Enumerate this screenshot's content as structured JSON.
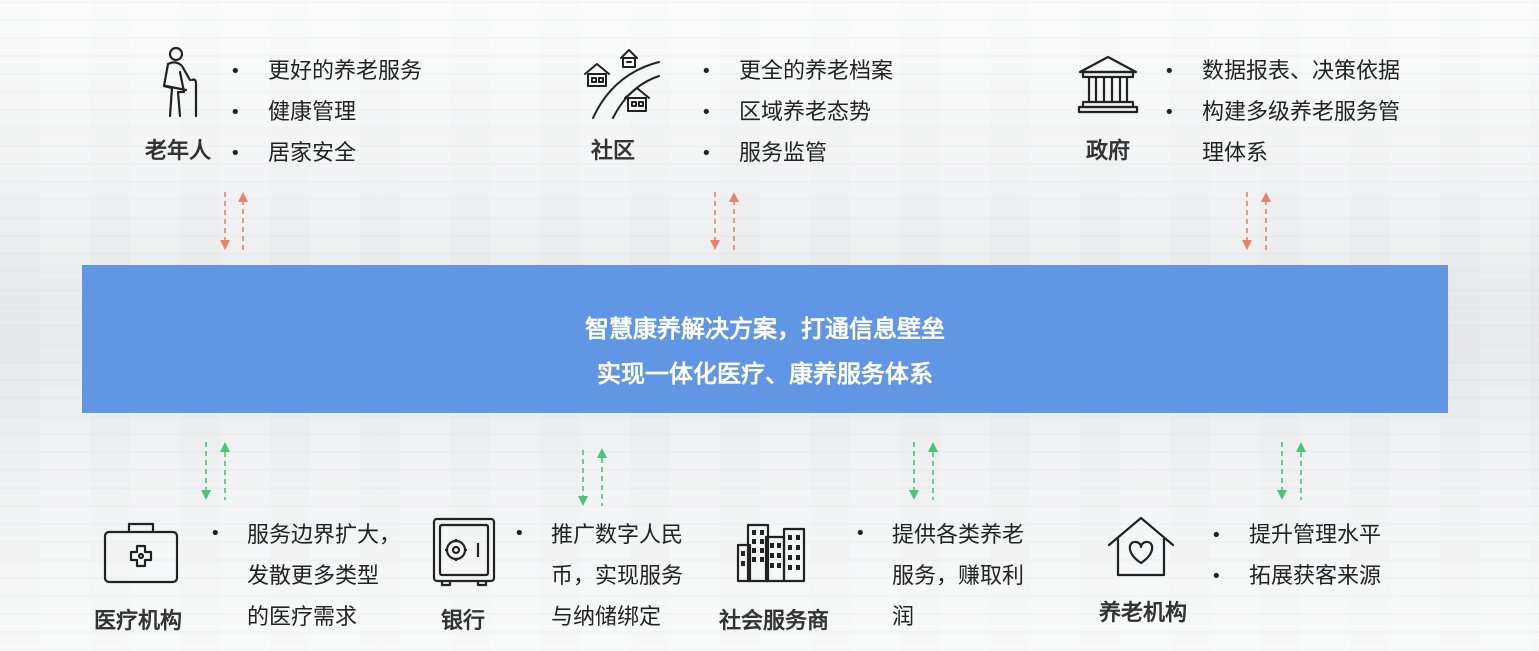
{
  "banner": {
    "line1": "智慧康养解决方案，打通信息壁垒",
    "line2": "实现一体化医疗、康养服务体系"
  },
  "colors": {
    "banner": "#6196e4",
    "arrow_top": "#e8826d",
    "arrow_bottom": "#4cc27a"
  },
  "top_nodes": [
    {
      "label": "老年人",
      "icon": "elderly-person-icon",
      "items": [
        "更好的养老服务",
        "健康管理",
        "居家安全"
      ]
    },
    {
      "label": "社区",
      "icon": "community-houses-icon",
      "items": [
        "更全的养老档案",
        "区域养老态势",
        "服务监管"
      ]
    },
    {
      "label": "政府",
      "icon": "government-building-icon",
      "items": [
        "数据报表、决策依据",
        "构建多级养老服务管",
        "理体系"
      ]
    }
  ],
  "bottom_nodes": [
    {
      "label": "医疗机构",
      "icon": "medical-kit-icon",
      "lines": [
        "服务边界扩大，",
        "发散更多类型",
        "的医疗需求"
      ]
    },
    {
      "label": "银行",
      "icon": "safe-icon",
      "lines": [
        "推广数字人民",
        "币，实现服务",
        "与纳储绑定"
      ]
    },
    {
      "label": "社会服务商",
      "icon": "office-buildings-icon",
      "lines": [
        "提供各类养老",
        "服务，赚取利",
        "润"
      ]
    },
    {
      "label": "养老机构",
      "icon": "heart-house-icon",
      "items": [
        "提升管理水平",
        "拓展获客来源"
      ]
    }
  ]
}
